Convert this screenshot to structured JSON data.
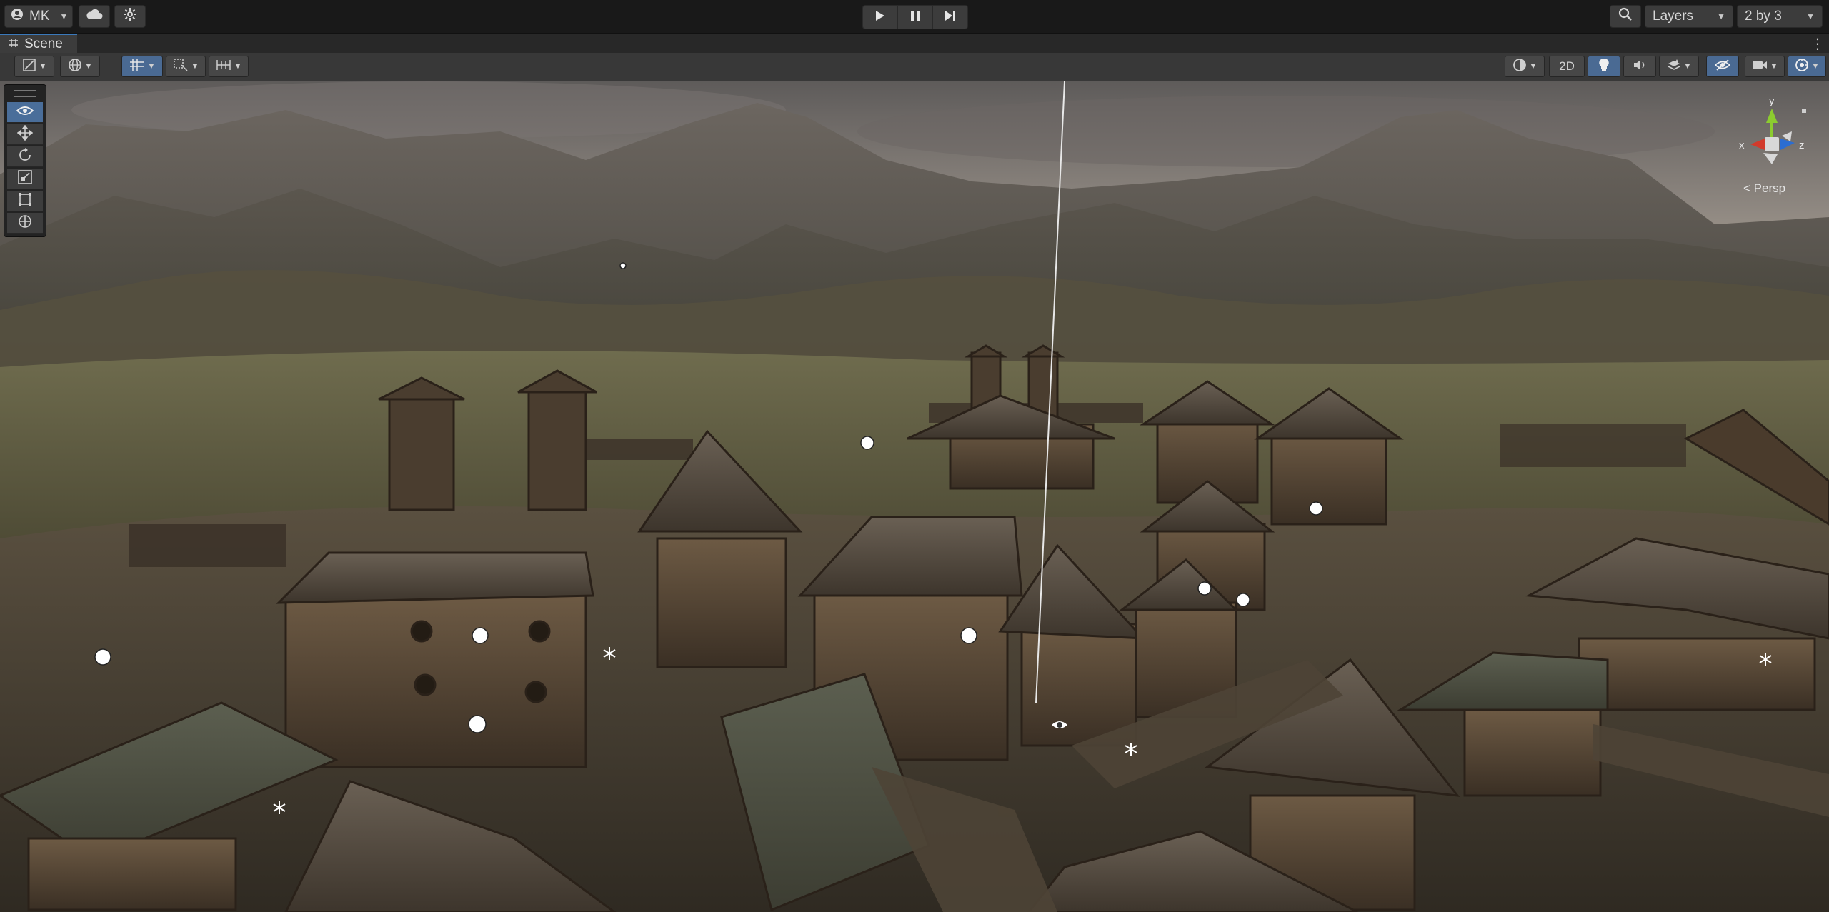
{
  "toolbar": {
    "account_label": "MK",
    "play_buttons": [
      "play",
      "pause",
      "step"
    ],
    "layers_label": "Layers",
    "layout_label": "2 by 3"
  },
  "tab": {
    "title": "Scene"
  },
  "scene_toolbar": {
    "mode_2d_label": "2D"
  },
  "gizmo": {
    "x_label": "x",
    "y_label": "y",
    "z_label": "z",
    "projection_label": "< Persp"
  },
  "colors": {
    "accent_blue": "#4a6e9a",
    "active_tab": "#3a79bb",
    "toolbar_bg": "#191919",
    "panel_bg": "#383838"
  },
  "icons": {
    "account": "account-icon",
    "cloud": "cloud-icon",
    "collab": "collab-icon",
    "play": "play-icon",
    "pause": "pause-icon",
    "step": "step-icon",
    "search": "search-icon",
    "scene_tab": "hash-icon",
    "tools": [
      "view-tool-icon",
      "move-tool-icon",
      "rotate-tool-icon",
      "scale-tool-icon",
      "rect-tool-icon",
      "transform-tool-icon"
    ]
  }
}
